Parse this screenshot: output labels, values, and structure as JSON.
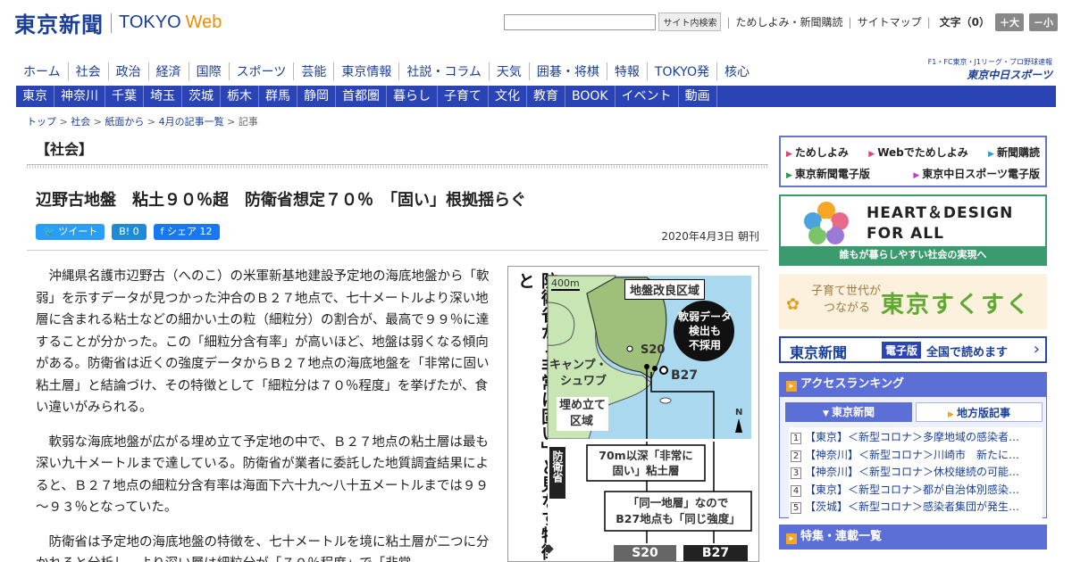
{
  "header": {
    "logo_kanji": "東京新聞",
    "logo_tokyo": "TOKYO",
    "logo_web": "Web",
    "search_button": "サイト内検索",
    "links": [
      "ためしよみ・新聞購読",
      "サイトマップ"
    ],
    "fontsize_label": "文字（0）",
    "font_larger": "＋大",
    "font_smaller": "－小"
  },
  "nav_main": [
    "ホーム",
    "社会",
    "政治",
    "経済",
    "国際",
    "スポーツ",
    "芸能",
    "東京情報",
    "社説・コラム",
    "天気",
    "囲碁・将棋",
    "特報",
    "TOKYO発",
    "核心"
  ],
  "sports_logo": {
    "small": "F1・FC東京・J1リーグ・プロ野球速報",
    "main": "東京中日スポーツ"
  },
  "nav_region": [
    "東京",
    "神奈川",
    "千葉",
    "埼玉",
    "茨城",
    "栃木",
    "群馬",
    "静岡",
    "首都圏",
    "暮らし",
    "子育て",
    "文化",
    "教育",
    "BOOK",
    "イベント",
    "動画"
  ],
  "breadcrumb": [
    "トップ",
    "社会",
    "紙面から",
    "4月の記事一覧",
    "記事"
  ],
  "article": {
    "section": "【社会】",
    "headline": "辺野古地盤　粘土９０％超　防衛省想定７０％　「固い」根拠揺らぐ",
    "share": {
      "tweet": "ツイート",
      "hatena": "B! 0",
      "facebook": "シェア 12"
    },
    "date": "2020年4月3日 朝刊",
    "paragraphs": [
      "沖縄県名護市辺野古（へのこ）の米軍新基地建設予定地の海底地盤から「軟弱」を示すデータが見つかった沖合のＢ２７地点で、七十メートルより深い地層に含まれる粘土などの細かい土の粒（細粒分）の割合が、最高で９９％に達することが分かった。この「細粒分含有率」が高いほど、地盤は弱くなる傾向がある。防衛省は近くの強度データからＢ２７地点の海底地盤を「非常に固い粘土層」と結論づけ、その特徴として「細粒分は７０％程度」を挙げたが、食い違いがみられる。",
      "軟弱な海底地盤が広がる埋め立て予定地の中で、Ｂ２７地点の粘土層は最も深い九十メートルまで達している。防衛省が業者に委託した地質調査結果によると、Ｂ２７地点の細粒分含有率は海面下六十九～八十五メートルまでは９９～９３％となっていた。",
      "防衛省は予定地の海底地盤の特徴を、七十メートルを境に粘土層が二つに分かれると分析し、より深い層は細粒分が「７０％程度」で「非常"
    ]
  },
  "figure": {
    "vertical_title": "防衛省が「非常に固い」と見なす特徴と",
    "scale": "400m",
    "label_improve": "地盤改良区域",
    "label_reject": [
      "軟弱データ",
      "検出も",
      "不採用"
    ],
    "label_camp": [
      "キャンプ・",
      "シュワブ"
    ],
    "label_fill": [
      "埋め立て",
      "区域"
    ],
    "point_s20": "S20",
    "point_b27": "B27",
    "north": "N",
    "mod_tag": "防衛省",
    "box1": [
      "70m以深「非常に",
      "固い」粘土層"
    ],
    "box2": [
      "「同一地層」なので",
      "B27地点も「同じ強度」"
    ],
    "bottom_s20": "S20",
    "bottom_b27": "B27",
    "marker": "◆"
  },
  "sidebar": {
    "links": [
      [
        "ためしよみ",
        "Webでためしよみ",
        "新聞購読"
      ],
      [
        "東京新聞電子版",
        "東京中日スポーツ電子版"
      ]
    ],
    "heart": {
      "line1": "HEART＆DESIGN",
      "line2": "FOR ALL",
      "sub": "誰もが暮らしやすい社会の実現へ"
    },
    "sukusuku": {
      "small1": "子育て世代が",
      "small2": "つながる",
      "big": "東京すくすく"
    },
    "epaper": {
      "logo": "東京新聞",
      "badge": "電子版",
      "text": "全国で読めます"
    },
    "ranking": {
      "title": "アクセスランキング",
      "tab1": "東京新聞",
      "tab2": "地方版記事",
      "items": [
        "【東京】＜新型コロナ＞多摩地域の感染者…",
        "【神奈川】＜新型コロナ＞川崎市　新たに…",
        "【神奈川】＜新型コロナ＞休校継続の可能…",
        "【東京】＜新型コロナ＞都が自治体別感染…",
        "【茨城】＜新型コロナ＞感染者集団が発生…"
      ]
    },
    "feature_title": "特集・連載一覧"
  },
  "colors": {
    "brand": "#1a3f9a",
    "nav_bg": "#2b44b5",
    "accent": "#f08c00",
    "sidebar_head": "#5b6fd6"
  }
}
